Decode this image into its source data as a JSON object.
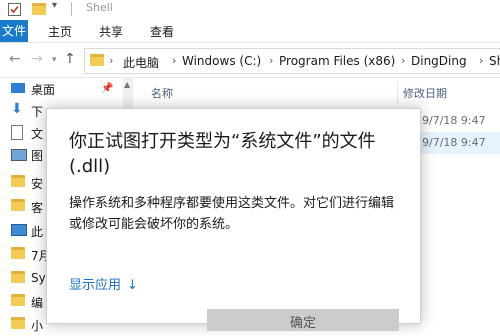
{
  "window": {
    "title": "Shell"
  },
  "ribbon": {
    "tabs": [
      "文件",
      "主页",
      "共享",
      "查看"
    ]
  },
  "address": {
    "back_icon": "back-arrow-icon",
    "forward_icon": "forward-arrow-icon",
    "up_icon": "up-arrow-icon",
    "crumbs": [
      "此电脑",
      "Windows (C:)",
      "Program Files (x86)",
      "DingDing",
      "Sh"
    ]
  },
  "nav_pane": {
    "items": [
      {
        "label": "桌面",
        "icon": "desktop-icon"
      },
      {
        "label": "下",
        "icon": "download-icon"
      },
      {
        "label": "文",
        "icon": "documents-icon"
      },
      {
        "label": "图",
        "icon": "pictures-icon"
      },
      {
        "label": "安",
        "icon": "folder-icon"
      },
      {
        "label": "客",
        "icon": "folder-icon"
      },
      {
        "label": "此",
        "icon": "this-pc-icon"
      },
      {
        "label": "7月",
        "icon": "folder-icon"
      },
      {
        "label": "Sy",
        "icon": "folder-icon"
      },
      {
        "label": "编",
        "icon": "folder-icon"
      },
      {
        "label": "小",
        "icon": "folder-icon"
      }
    ]
  },
  "file_list": {
    "columns": {
      "name": "名称",
      "modified": "修改日期"
    },
    "rows": [
      {
        "modified": "9/7/18 9:47"
      },
      {
        "modified": "9/7/18 9:47"
      }
    ]
  },
  "dialog": {
    "title": "你正试图打开类型为“系统文件”的文件(.dll)",
    "body": "操作系统和多种程序都要使用这类文件。对它们进行编辑或修改可能会破坏你的系统。",
    "show_apps_link": "显示应用",
    "show_apps_icon": "chevron-down-icon",
    "ok_button": "确定"
  },
  "colors": {
    "accent": "#1979ca",
    "link": "#1a6fc9",
    "folder": "#f4cc52"
  }
}
